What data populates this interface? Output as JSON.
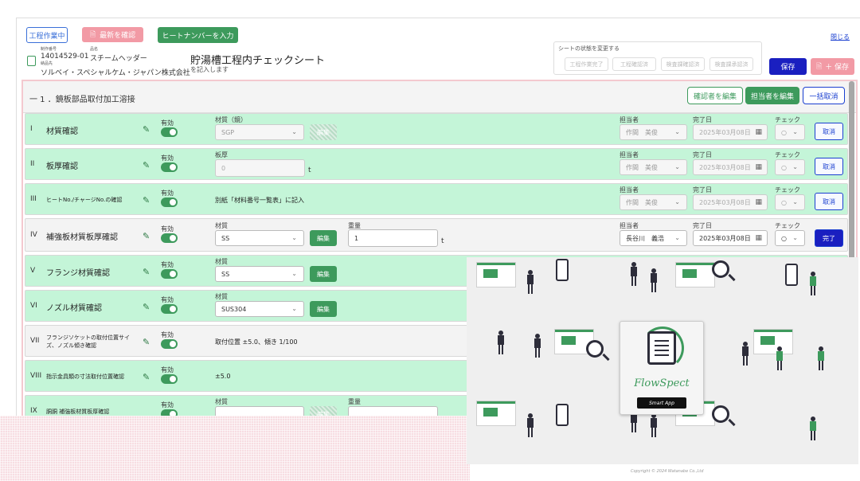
{
  "header": {
    "status_button": "工程作業中",
    "confirm_latest": "最新を確認",
    "heat_number": "ヒートナンバーを入力",
    "close_link": "閉じる",
    "mfg_no_label": "制作番号",
    "mfg_no": "14014529-01",
    "product_label": "品名",
    "product": "スチームヘッダー",
    "dest_label": "納品先",
    "dest": "ソルベイ・スペシャルケム・ジャパン株式会社",
    "sheet_title": "貯湯槽工程内チェックシート",
    "sheet_sub": "を記入します",
    "state_label": "シートの状態を変更する",
    "state_buttons": [
      "工程作業完了",
      "工程確認済",
      "検査課確認済",
      "検査課承認済"
    ],
    "save": "保存",
    "save_plus": "＋ 保存"
  },
  "section": {
    "title": "一 1 ．鏡板部品取付加工溶接",
    "edit_checker": "確認者を編集",
    "edit_owner": "担当者を編集",
    "bulk_cancel": "一括取消"
  },
  "common": {
    "enabled": "有効",
    "owner": "担当者",
    "done_date": "完了日",
    "check": "チェック",
    "edit": "編集",
    "check_value": "○",
    "unit_t": "t"
  },
  "rows": [
    {
      "roman": "I",
      "label": "材質確認",
      "f1_label": "材質（鏡）",
      "f1_value": "SGP",
      "owner": "作間　美俊",
      "date": "2025年03月08日",
      "action": "取消"
    },
    {
      "roman": "II",
      "label": "板厚確認",
      "f1_label": "板厚",
      "f1_value": "0",
      "owner": "作間　美俊",
      "date": "2025年03月08日",
      "action": "取消"
    },
    {
      "roman": "III",
      "label": "ヒートNo./チャージNo.の確認",
      "text": "別紙「材料番号一覧表」に記入",
      "owner": "作間　美俊",
      "date": "2025年03月08日",
      "action": "取消"
    },
    {
      "roman": "IV",
      "label": "補強板材質板厚確認",
      "f1_label": "材質",
      "f1_value": "SS",
      "f2_label": "重量",
      "f2_value": "1",
      "owner": "長谷川　義浩",
      "date": "2025年03月08日",
      "action": "完了"
    },
    {
      "roman": "V",
      "label": "フランジ材質確認",
      "f1_label": "材質",
      "f1_value": "SS"
    },
    {
      "roman": "VI",
      "label": "ノズル材質確認",
      "f1_label": "材質",
      "f1_value": "SUS304"
    },
    {
      "roman": "VII",
      "label": "フランジソケットの取付位置サイズ、ノズル傾き確認",
      "text": "取付位置 ±5.0、傾き 1/100"
    },
    {
      "roman": "VIII",
      "label": "指示金具類の寸法取付位置確認",
      "text": "±5.0"
    },
    {
      "roman": "IX",
      "label": "胴胴 補強板材質板厚確認",
      "f1_label": "材質",
      "f2_label": "重量"
    }
  ],
  "overlay": {
    "brand": "FlowSpect",
    "badge": "Smart App",
    "copyright": "Copyright © 2024 Watanabe Co.,Ltd"
  }
}
